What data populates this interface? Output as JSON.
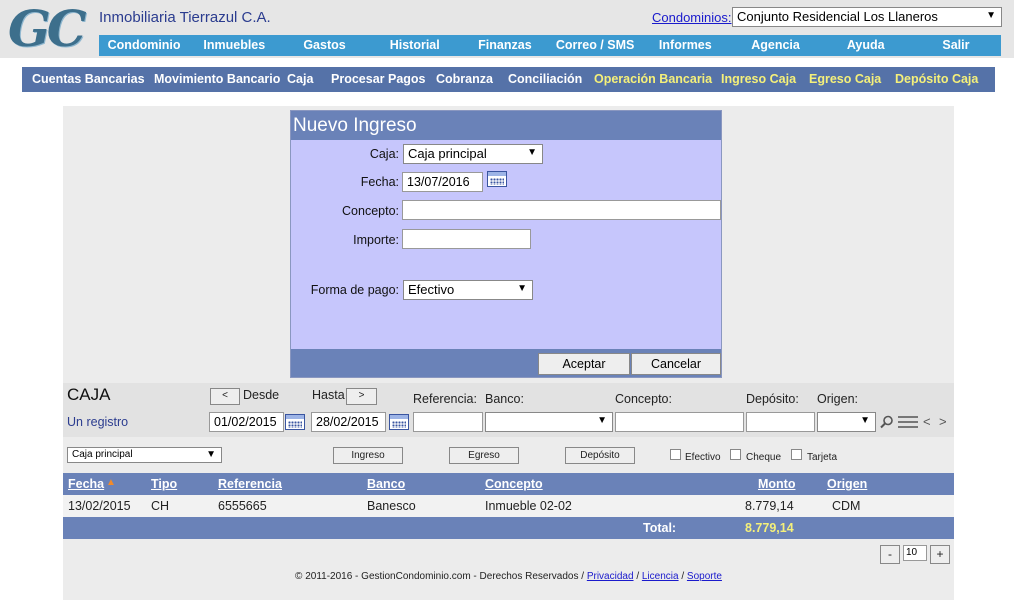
{
  "header": {
    "logo_text": "GC",
    "company": "Inmobiliaria Tierrazul C.A.",
    "condominios_label": "Condominios:",
    "condominio_selected": "Conjunto Residencial Los Llaneros"
  },
  "main_nav": [
    "Condominio",
    "Inmuebles",
    "Gastos",
    "Historial",
    "Finanzas",
    "Correo / SMS",
    "Informes",
    "Agencia",
    "Ayuda",
    "Salir"
  ],
  "sub_nav": [
    {
      "label": "Cuentas Bancarias",
      "highlight": false
    },
    {
      "label": "Movimiento Bancario",
      "highlight": false
    },
    {
      "label": "Caja",
      "highlight": false
    },
    {
      "label": "Procesar Pagos",
      "highlight": false
    },
    {
      "label": "Cobranza",
      "highlight": false
    },
    {
      "label": "Conciliación",
      "highlight": false
    },
    {
      "label": "Operación Bancaria",
      "highlight": true
    },
    {
      "label": "Ingreso Caja",
      "highlight": true
    },
    {
      "label": "Egreso Caja",
      "highlight": true
    },
    {
      "label": "Depósito Caja",
      "highlight": true
    }
  ],
  "form": {
    "title": "Nuevo Ingreso",
    "caja_label": "Caja:",
    "caja_value": "Caja principal",
    "fecha_label": "Fecha:",
    "fecha_value": "13/07/2016",
    "concepto_label": "Concepto:",
    "concepto_value": "",
    "importe_label": "Importe:",
    "importe_value": "",
    "forma_pago_label": "Forma de pago:",
    "forma_pago_value": "Efectivo",
    "accept_label": "Aceptar",
    "cancel_label": "Cancelar"
  },
  "filters": {
    "title": "CAJA",
    "record_count": "Un registro",
    "prev_symbol": "<",
    "next_symbol": ">",
    "desde_label": "Desde",
    "hasta_label": "Hasta",
    "desde_value": "01/02/2015",
    "hasta_value": "28/02/2015",
    "referencia_label": "Referencia:",
    "banco_label": "Banco:",
    "concepto_label": "Concepto:",
    "deposito_label": "Depósito:",
    "origen_label": "Origen:",
    "page_prev": "<",
    "page_next": ">"
  },
  "actions": {
    "caja_select": "Caja principal",
    "ingreso_label": "Ingreso",
    "egreso_label": "Egreso",
    "deposito_label": "Depósito",
    "efectivo_label": "Efectivo",
    "cheque_label": "Cheque",
    "tarjeta_label": "Tarjeta"
  },
  "table": {
    "headers": {
      "fecha": "Fecha",
      "tipo": "Tipo",
      "referencia": "Referencia",
      "banco": "Banco",
      "concepto": "Concepto",
      "monto": "Monto",
      "origen": "Origen"
    },
    "rows": [
      {
        "fecha": "13/02/2015",
        "tipo": "CH",
        "referencia": "6555665",
        "banco": "Banesco",
        "concepto": "Inmueble 02-02",
        "monto": "8.779,14",
        "origen": "CDM"
      }
    ],
    "total_label": "Total:",
    "total_value": "8.779,14"
  },
  "pagination": {
    "minus": "-",
    "page_size": "10",
    "plus": "+"
  },
  "footer": {
    "copyright": "© 2011-2016 - GestionCondominio.com - Derechos Reservados /",
    "privacidad": "Privacidad",
    "licencia": "Licencia",
    "soporte": "Soporte",
    "sep": "/"
  },
  "colors": {
    "accent_blue": "#3c9ad0",
    "panel_blue": "#6a82b8",
    "subnav": "#5572a8",
    "highlight_yellow": "#f5f07a",
    "form_bg": "#c6c6fc"
  }
}
